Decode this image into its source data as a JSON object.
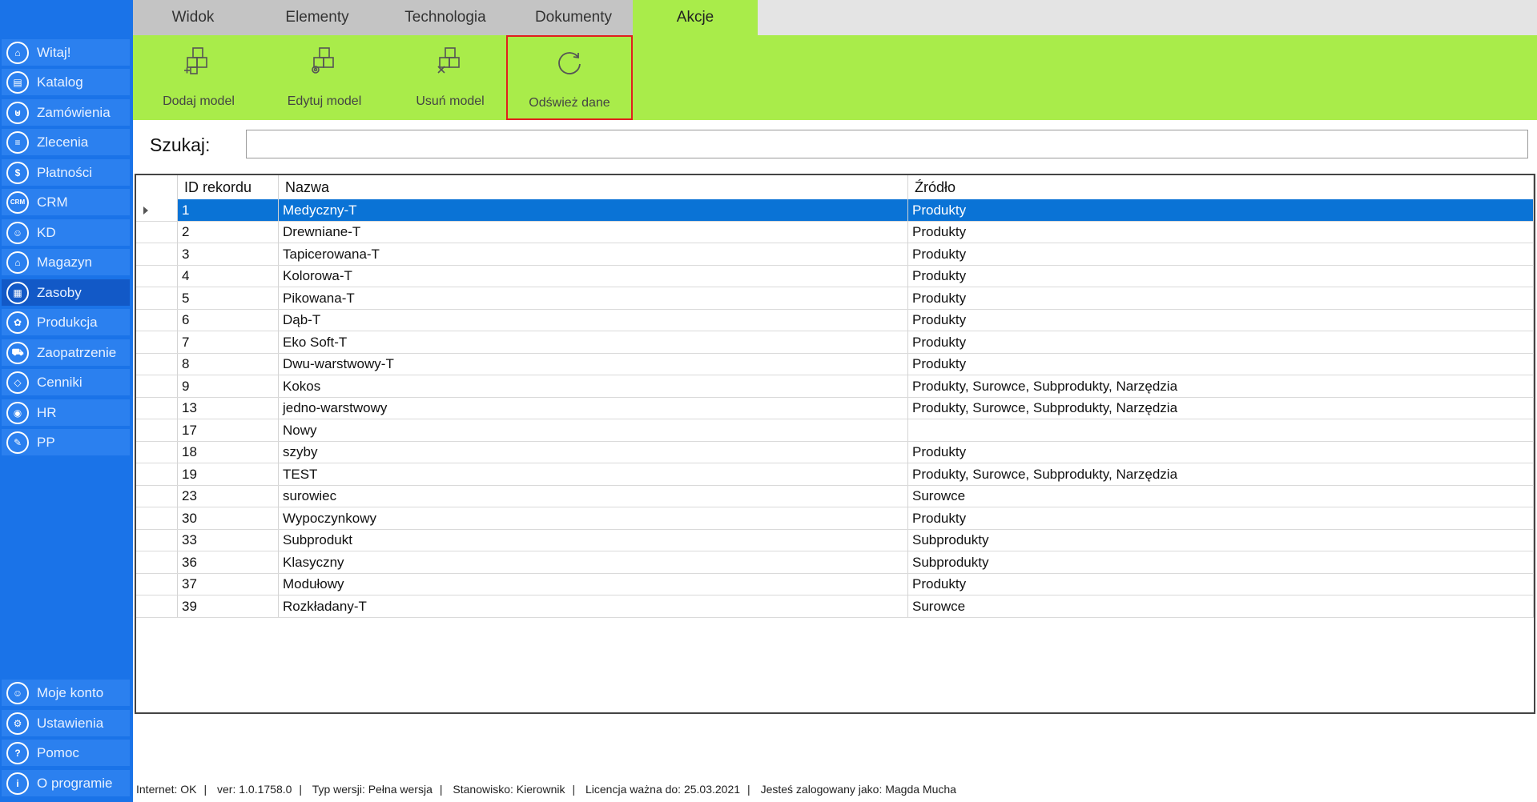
{
  "tabs": [
    "Widok",
    "Elementy",
    "Technologia",
    "Dokumenty",
    "Akcje"
  ],
  "ribbon": {
    "add_model": "Dodaj model",
    "edit_model": "Edytuj model",
    "delete_model": "Usuń model",
    "refresh": "Odśwież dane"
  },
  "sidebar": {
    "items": [
      {
        "label": "Witaj!",
        "icon": "home-icon"
      },
      {
        "label": "Katalog",
        "icon": "book-icon"
      },
      {
        "label": "Zamówienia",
        "icon": "cart-icon"
      },
      {
        "label": "Zlecenia",
        "icon": "list-icon"
      },
      {
        "label": "Płatności",
        "icon": "dollar-icon"
      },
      {
        "label": "CRM",
        "icon": "crm-icon"
      },
      {
        "label": "KD",
        "icon": "person-icon"
      },
      {
        "label": "Magazyn",
        "icon": "warehouse-icon"
      },
      {
        "label": "Zasoby",
        "icon": "resources-icon"
      },
      {
        "label": "Produkcja",
        "icon": "production-icon"
      },
      {
        "label": "Zaopatrzenie",
        "icon": "truck-icon"
      },
      {
        "label": "Cenniki",
        "icon": "tag-icon"
      },
      {
        "label": "HR",
        "icon": "hr-icon"
      },
      {
        "label": "PP",
        "icon": "pp-icon"
      }
    ],
    "bottom": [
      {
        "label": "Moje konto",
        "icon": "account-icon"
      },
      {
        "label": "Ustawienia",
        "icon": "gear-icon"
      },
      {
        "label": "Pomoc",
        "icon": "help-icon"
      },
      {
        "label": "O programie",
        "icon": "info-icon"
      }
    ]
  },
  "search": {
    "label": "Szukaj:",
    "value": ""
  },
  "grid": {
    "headers": [
      "ID rekordu",
      "Nazwa",
      "Źródło"
    ],
    "rows": [
      [
        "1",
        "Medyczny-T",
        "Produkty"
      ],
      [
        "2",
        "Drewniane-T",
        "Produkty"
      ],
      [
        "3",
        "Tapicerowana-T",
        "Produkty"
      ],
      [
        "4",
        "Kolorowa-T",
        "Produkty"
      ],
      [
        "5",
        "Pikowana-T",
        "Produkty"
      ],
      [
        "6",
        "Dąb-T",
        "Produkty"
      ],
      [
        "7",
        "Eko Soft-T",
        "Produkty"
      ],
      [
        "8",
        "Dwu-warstwowy-T",
        "Produkty"
      ],
      [
        "9",
        "Kokos",
        "Produkty, Surowce, Subprodukty, Narzędzia"
      ],
      [
        "13",
        "jedno-warstwowy",
        "Produkty, Surowce, Subprodukty, Narzędzia"
      ],
      [
        "17",
        "Nowy",
        ""
      ],
      [
        "18",
        "szyby",
        "Produkty"
      ],
      [
        "19",
        "TEST",
        "Produkty, Surowce, Subprodukty, Narzędzia"
      ],
      [
        "23",
        "surowiec",
        "Surowce"
      ],
      [
        "30",
        "Wypoczynkowy",
        "Produkty"
      ],
      [
        "33",
        "Subprodukt",
        "Subprodukty"
      ],
      [
        "36",
        "Klasyczny",
        "Subprodukty"
      ],
      [
        "37",
        "Modułowy",
        "Produkty"
      ],
      [
        "39",
        "Rozkładany-T",
        "Surowce"
      ]
    ]
  },
  "status": [
    "Internet: OK",
    "ver: 1.0.1758.0",
    "Typ wersji: Pełna wersja",
    "Stanowisko: Kierownik",
    "Licencja ważna do: 25.03.2021",
    "Jesteś zalogowany jako: Magda Mucha"
  ],
  "colors": {
    "sidebar": "#1a73e8",
    "accent": "#a9ec4a",
    "selection": "#0a73d6",
    "highlight": "#e0201e"
  }
}
